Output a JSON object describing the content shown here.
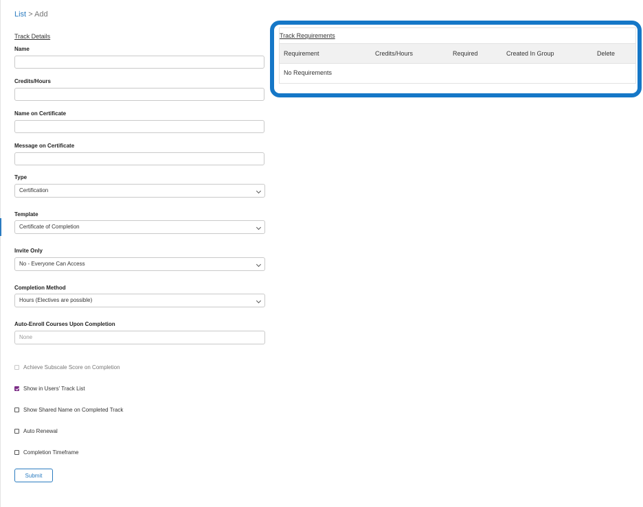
{
  "breadcrumb": {
    "list_link": "List",
    "separator": ">",
    "current": "Add"
  },
  "track_details": {
    "title": "Track Details",
    "fields": {
      "name": {
        "label": "Name",
        "value": ""
      },
      "credits": {
        "label": "Credits/Hours",
        "value": ""
      },
      "name_on_certificate": {
        "label": "Name on Certificate",
        "value": ""
      },
      "message_on_certificate": {
        "label": "Message on Certificate",
        "value": ""
      },
      "type": {
        "label": "Type",
        "selected": "Certification"
      },
      "template": {
        "label": "Template",
        "selected": "Certificate of Completion"
      },
      "invite_only": {
        "label": "Invite Only",
        "selected": "No - Everyone Can Access"
      },
      "completion_method": {
        "label": "Completion Method",
        "selected": "Hours (Electives are possible)"
      },
      "auto_enroll": {
        "label": "Auto-Enroll Courses Upon Completion",
        "placeholder": "None"
      }
    },
    "checkboxes": {
      "achieve_subscale": {
        "label": "Achieve Subscale Score on Completion",
        "checked": false,
        "disabled": true
      },
      "show_in_track_list": {
        "label": "Show in Users' Track List",
        "checked": true
      },
      "show_shared_name": {
        "label": "Show Shared Name on Completed Track",
        "checked": false
      },
      "auto_renewal": {
        "label": "Auto Renewal",
        "checked": false
      },
      "completion_timeframe": {
        "label": "Completion Timeframe",
        "checked": false
      }
    },
    "submit_label": "Submit"
  },
  "track_requirements": {
    "title": "Track Requirements",
    "columns": [
      "Requirement",
      "Credits/Hours",
      "Required",
      "Created In Group",
      "Delete"
    ],
    "empty_message": "No Requirements"
  },
  "colors": {
    "link": "#2a7bc0",
    "highlight_frame": "#1577c7",
    "checkbox_checked": "#7b2d86"
  }
}
